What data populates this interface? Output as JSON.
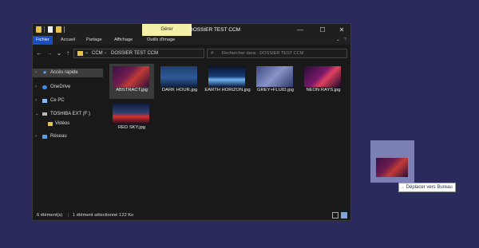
{
  "window": {
    "manage_tab": "Gérer",
    "title": "DOSSIER TEST CCM",
    "controls": [
      "—",
      "☐",
      "✕"
    ]
  },
  "ribbon": {
    "tabs": [
      "Fichier",
      "Accueil",
      "Partage",
      "Affichage",
      "Outils d'image"
    ],
    "expand": "⌄",
    "help": "?"
  },
  "address": {
    "back": "←",
    "forward": "→",
    "dropdown": "⌄",
    "up": "↑",
    "sep1": "«",
    "crumbs": [
      "CCM",
      "DOSSIER TEST CCM"
    ],
    "crumb_sep": "›",
    "dropdown2": "⌄",
    "refresh": "↻",
    "search_placeholder": "Rechercher dans : DOSSIER TEST CCM"
  },
  "nav": [
    {
      "label": "Accès rapide",
      "icon": "star-icon",
      "color": "#5aa8ff",
      "selected": true
    },
    {
      "label": "OneDrive",
      "icon": "cloud-icon",
      "color": "#3b8cea"
    },
    {
      "label": "Ce PC",
      "icon": "computer-icon",
      "color": "#8ab8f0"
    },
    {
      "label": "TOSHIBA EXT (F:)",
      "icon": "drive-icon",
      "color": "#bbbbbb",
      "expanded": true
    },
    {
      "label": "Vidéos",
      "icon": "folder-icon",
      "color": "#e8c14a",
      "child": true
    },
    {
      "label": "Réseau",
      "icon": "network-icon",
      "color": "#4ea0e8"
    }
  ],
  "files": [
    {
      "name": "ABSTRACT.jpg",
      "selected": true,
      "gradient": "linear-gradient(135deg,#3a1046 0%,#6e1d4e 40%,#c23a36 60%,#2a0f3a 100%)"
    },
    {
      "name": "DARK HOUR.jpg",
      "gradient": "linear-gradient(180deg,#1f3d70 0%,#2e5a96 55%,#0f2244 100%)"
    },
    {
      "name": "EARTH HORIZON.jpg",
      "gradient": "linear-gradient(180deg,#0a1430 0%,#1a3c78 50%,#6eb4ee 65%,#0c1a3a 100%)"
    },
    {
      "name": "GREY+FLUID.jpg",
      "gradient": "linear-gradient(135deg,#3d4a80 0%,#8894c8 50%,#2e3a6a 100%)"
    },
    {
      "name": "NEON RAYS.jpg",
      "gradient": "linear-gradient(135deg,#2a0a3a 0%,#7a1a6a 45%,#e04060 60%,#1a0828 100%)"
    },
    {
      "name": "RED SKY.jpg",
      "gradient": "linear-gradient(180deg,#101e3c 0%,#2d3f70 45%,#d83030 62%,#140c20 100%)"
    }
  ],
  "status": {
    "count": "6 élément(s)",
    "selection": "1 élément sélectionné  122 Ko"
  },
  "drag": {
    "tooltip_arrow": "→",
    "tooltip_text": "Déplacer vers Bureau",
    "gradient": "linear-gradient(135deg,#3a1046 0%,#6e1d4e 40%,#c23a36 60%,#2a0f3a 100%)"
  }
}
